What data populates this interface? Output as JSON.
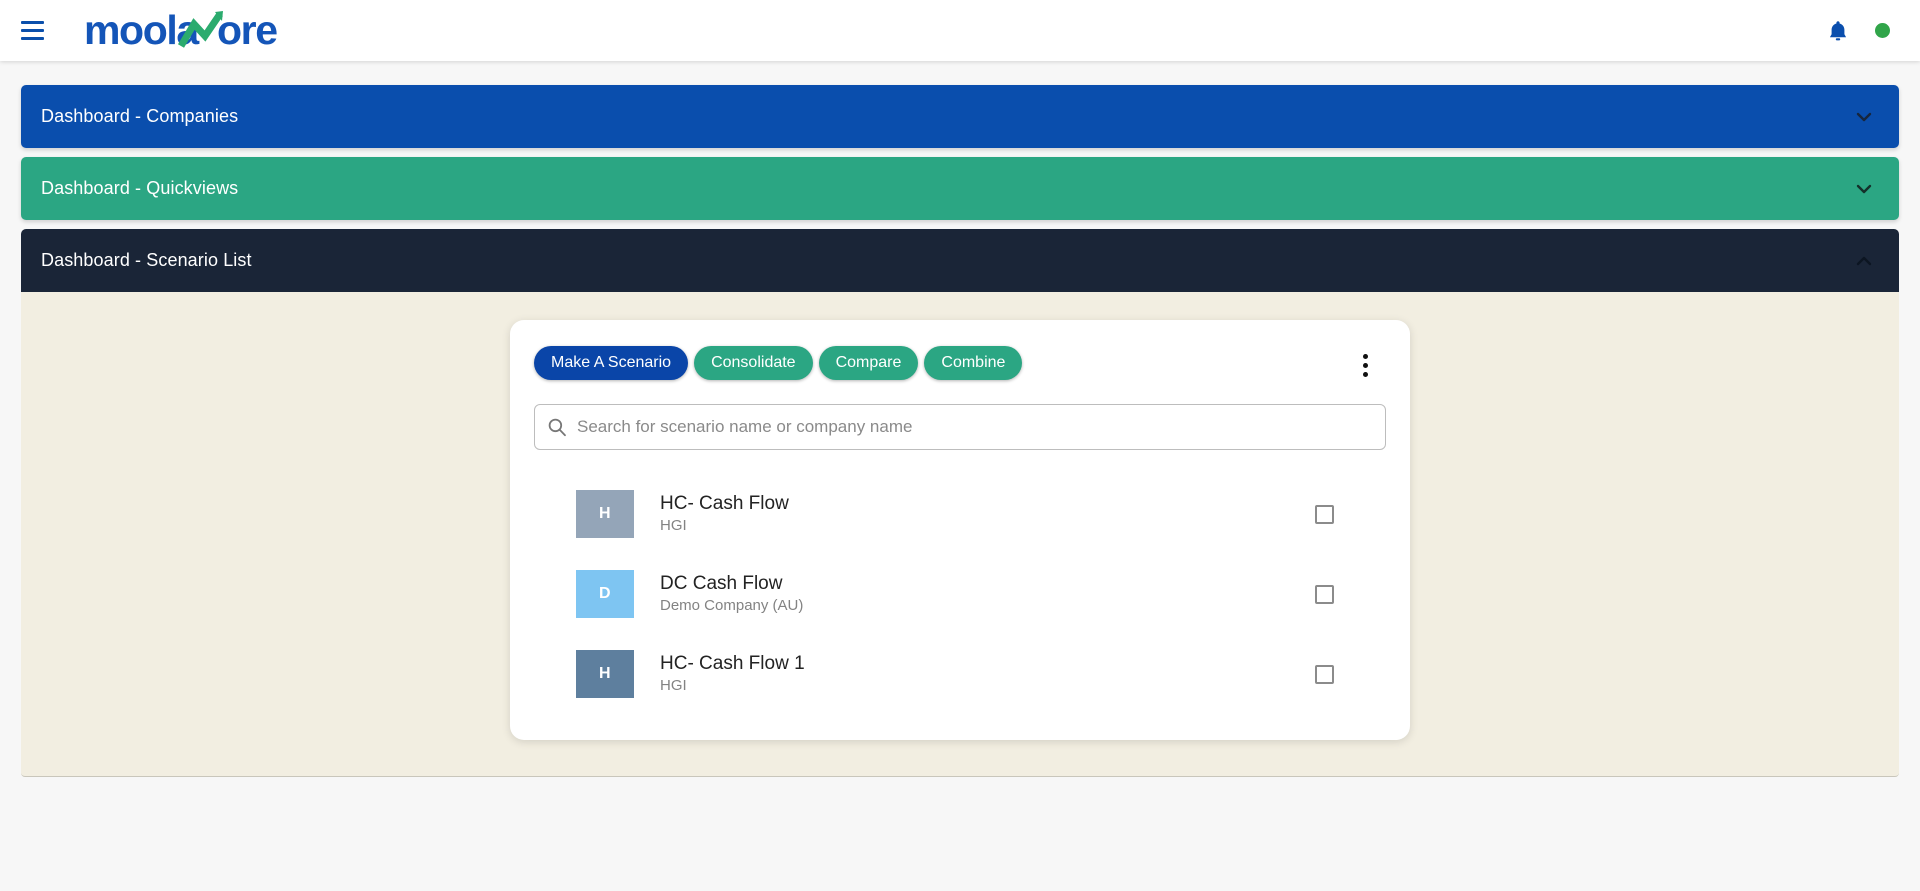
{
  "topbar": {
    "menu_icon": "hamburger-menu-icon",
    "brand_name": "moolaMore",
    "brand_part_1": "moola",
    "brand_part_2": "ore",
    "notification_icon": "bell-icon",
    "status_indicator": "online-status-dot",
    "colors": {
      "brand_blue": "#1455b8",
      "brand_green": "#2ba683",
      "status_green": "#31a54a"
    }
  },
  "accordions": [
    {
      "id": "companies",
      "title": "Dashboard - Companies",
      "color": "#0a4ead",
      "expanded": false,
      "chevron": "chevron-down-icon"
    },
    {
      "id": "quickviews",
      "title": "Dashboard - Quickviews",
      "color": "#2ba683",
      "expanded": false,
      "chevron": "chevron-down-icon"
    },
    {
      "id": "scenario-list",
      "title": "Dashboard - Scenario List",
      "color": "#1a2537",
      "expanded": true,
      "chevron": "chevron-up-icon"
    }
  ],
  "scenario_panel": {
    "background_color": "#f2eee1",
    "tabs": [
      {
        "label": "Make A Scenario",
        "active": true,
        "color": "#0a45a8"
      },
      {
        "label": "Consolidate",
        "active": false,
        "color": "#2ba683"
      },
      {
        "label": "Compare",
        "active": false,
        "color": "#2ba683"
      },
      {
        "label": "Combine",
        "active": false,
        "color": "#2ba683"
      }
    ],
    "overflow_menu_icon": "kebab-menu-icon",
    "search": {
      "icon": "search-icon",
      "placeholder": "Search for scenario name or company name",
      "value": ""
    },
    "scenarios": [
      {
        "initial": "H",
        "avatar_color": "#94a5b8",
        "name": "HC- Cash Flow",
        "company": "HGI",
        "selected": false
      },
      {
        "initial": "D",
        "avatar_color": "#7ec5f2",
        "name": "DC Cash Flow",
        "company": "Demo Company (AU)",
        "selected": false
      },
      {
        "initial": "H",
        "avatar_color": "#5e7f9e",
        "name": "HC- Cash Flow 1",
        "company": "HGI",
        "selected": false
      }
    ]
  }
}
